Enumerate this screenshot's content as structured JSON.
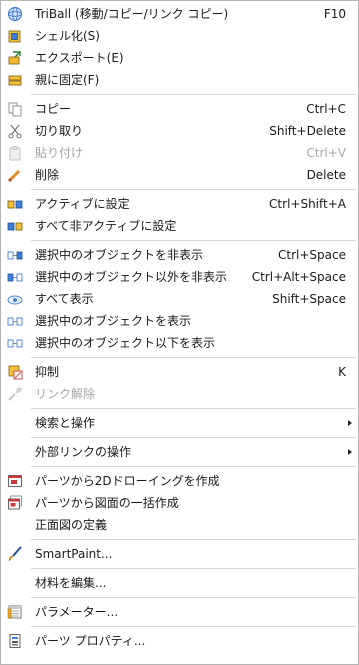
{
  "menu": {
    "items": {
      "triball": {
        "label": "TriBall (移動/コピー/リンク コピー)",
        "shortcut": "F10",
        "icon": "triball-icon"
      },
      "shell": {
        "label": "シェル化(S)",
        "icon": "shell-icon"
      },
      "export": {
        "label": "エクスポート(E)",
        "icon": "export-icon"
      },
      "fix_parent": {
        "label": "親に固定(F)",
        "icon": "fix-parent-icon"
      },
      "copy": {
        "label": "コピー",
        "shortcut": "Ctrl+C",
        "icon": "copy-icon"
      },
      "cut": {
        "label": "切り取り",
        "shortcut": "Shift+Delete",
        "icon": "scissors-icon"
      },
      "paste": {
        "label": "貼り付け",
        "shortcut": "Ctrl+V",
        "icon": "paste-icon",
        "disabled": true
      },
      "delete": {
        "label": "削除",
        "shortcut": "Delete",
        "icon": "eraser-icon"
      },
      "set_active": {
        "label": "アクティブに設定",
        "shortcut": "Ctrl+Shift+A",
        "icon": "active-icon"
      },
      "set_all_inactive": {
        "label": "すべて非アクティブに設定",
        "icon": "inactive-icon"
      },
      "hide_selected": {
        "label": "選択中のオブジェクトを非表示",
        "shortcut": "Ctrl+Space",
        "icon": "hide-selected-icon"
      },
      "hide_unselected": {
        "label": "選択中のオブジェクト以外を非表示",
        "shortcut": "Ctrl+Alt+Space",
        "icon": "hide-others-icon"
      },
      "show_all": {
        "label": "すべて表示",
        "shortcut": "Shift+Space",
        "icon": "show-all-icon"
      },
      "show_selected": {
        "label": "選択中のオブジェクトを表示",
        "icon": "show-selected-icon"
      },
      "show_below": {
        "label": "選択中のオブジェクト以下を表示",
        "icon": "show-below-icon"
      },
      "suppress": {
        "label": "抑制",
        "shortcut": "K",
        "icon": "suppress-icon"
      },
      "unlink": {
        "label": "リンク解除",
        "icon": "unlink-icon",
        "disabled": true
      },
      "search_ops": {
        "label": "検索と操作",
        "submenu": true
      },
      "external_links": {
        "label": "外部リンクの操作",
        "submenu": true
      },
      "create_2d": {
        "label": "パーツから2Dドローイングを作成",
        "icon": "drawing-2d-icon"
      },
      "batch_drawings": {
        "label": "パーツから図面の一括作成",
        "icon": "batch-drawing-icon"
      },
      "front_view": {
        "label": "正面図の定義"
      },
      "smartpaint": {
        "label": "SmartPaint...",
        "icon": "paintbrush-icon"
      },
      "edit_material": {
        "label": "材料を編集..."
      },
      "parameters": {
        "label": "パラメーター...",
        "icon": "parameters-icon"
      },
      "part_properties": {
        "label": "パーツ プロパティ...",
        "icon": "properties-icon"
      }
    }
  }
}
